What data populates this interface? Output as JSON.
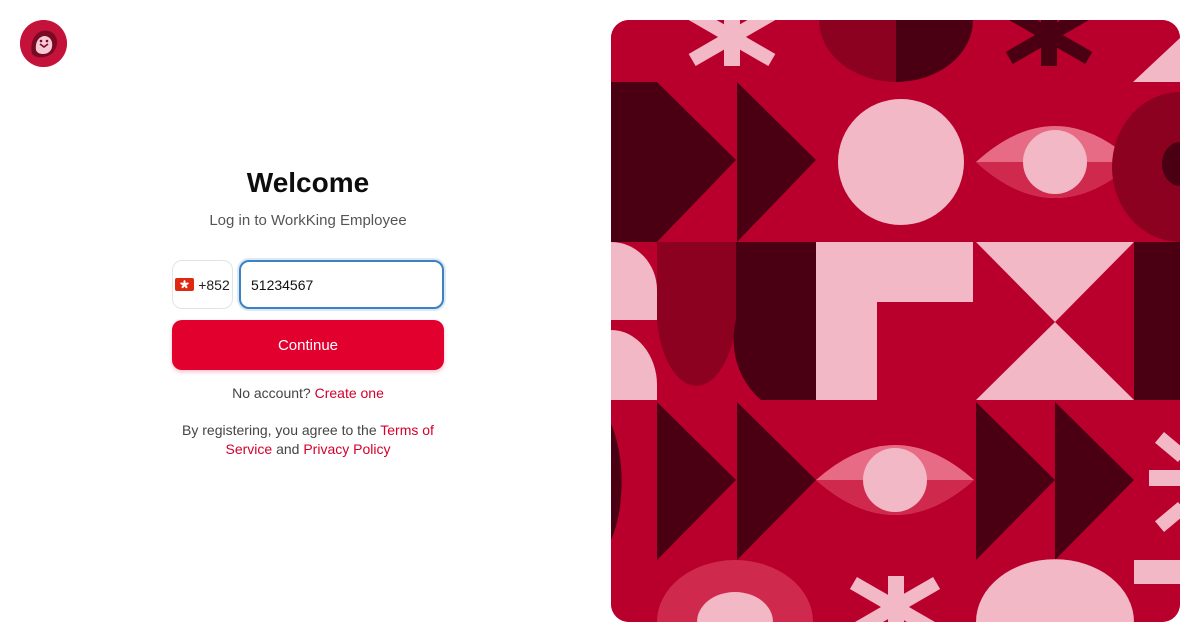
{
  "brand": {
    "logo_icon": "lion-logo-icon"
  },
  "login": {
    "title": "Welcome",
    "subtitle": "Log in to WorkKing Employee",
    "country_code": "+852",
    "flag_icon": "hong-kong-flag-icon",
    "phone_value": "51234567",
    "continue_label": "Continue",
    "no_account_text": "No account?",
    "create_account_link": "Create one",
    "terms_prefix": "By registering, you agree to the",
    "terms_link": "Terms of Service",
    "terms_conjunction": "and",
    "privacy_link": "Privacy Policy"
  },
  "colors": {
    "accent": "#e2002f",
    "link": "#d4002b",
    "focus_border": "#3b82c4",
    "pattern_red": "#b9002c",
    "pattern_dark": "#4a0012",
    "pattern_pink": "#f2b8c6"
  }
}
